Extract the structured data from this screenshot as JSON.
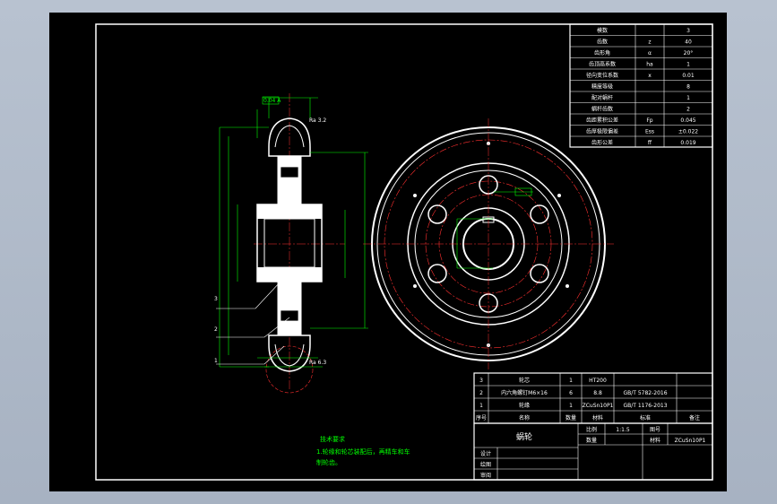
{
  "params": {
    "rows": [
      {
        "label": "模数",
        "sym": "",
        "val": "3"
      },
      {
        "label": "齿数",
        "sym": "z",
        "val": "40"
      },
      {
        "label": "齿形角",
        "sym": "α",
        "val": "20°"
      },
      {
        "label": "齿顶高系数",
        "sym": "ha",
        "val": "1"
      },
      {
        "label": "径向变位系数",
        "sym": "x",
        "val": "0.01"
      },
      {
        "label": "精度等级",
        "sym": "",
        "val": "8"
      },
      {
        "label": "配对蜗杆",
        "sym": "",
        "val": "1"
      },
      {
        "label": "蜗杆齿数",
        "sym": "",
        "val": "2"
      },
      {
        "label": "齿距累积公差",
        "sym": "Fp",
        "val": "0.045"
      },
      {
        "label": "齿厚极限偏差",
        "sym": "Ess",
        "val": "±0.022"
      },
      {
        "label": "齿形公差",
        "sym": "ff",
        "val": "0.019"
      }
    ]
  },
  "bom": {
    "rows": [
      {
        "no": "3",
        "name": "轮芯",
        "qty": "1",
        "mat": "HT200",
        "std": ""
      },
      {
        "no": "2",
        "name": "内六角螺钉M6×16",
        "qty": "6",
        "mat": "8.8",
        "std": "GB/T 5782-2016"
      },
      {
        "no": "1",
        "name": "轮缘",
        "qty": "1",
        "mat": "ZCuSn10P1",
        "std": "GB/T 1176-2013"
      }
    ],
    "header": {
      "no": "序号",
      "name": "名称",
      "qty": "数量",
      "mat": "材料",
      "std": "标准",
      "note": "备注"
    }
  },
  "title_block": {
    "title": "蜗轮",
    "scale_label": "比例",
    "scale": "1:1.5",
    "drawing_no_label": "图号",
    "qty_label": "数量",
    "material_label": "材料",
    "material": "ZCuSn10P1",
    "design": "设计",
    "draw": "绘图",
    "check": "审阅"
  },
  "tech": {
    "heading": "技术要求",
    "line1": "1.轮缘和轮芯装配后，再精车和车",
    "line2": "制轮齿。"
  },
  "callouts": {
    "c1": "1",
    "c2": "2",
    "c3": "3",
    "ra": "Ra 3.2",
    "ref": "Ra 6.3",
    "tol": "0.04 A"
  }
}
